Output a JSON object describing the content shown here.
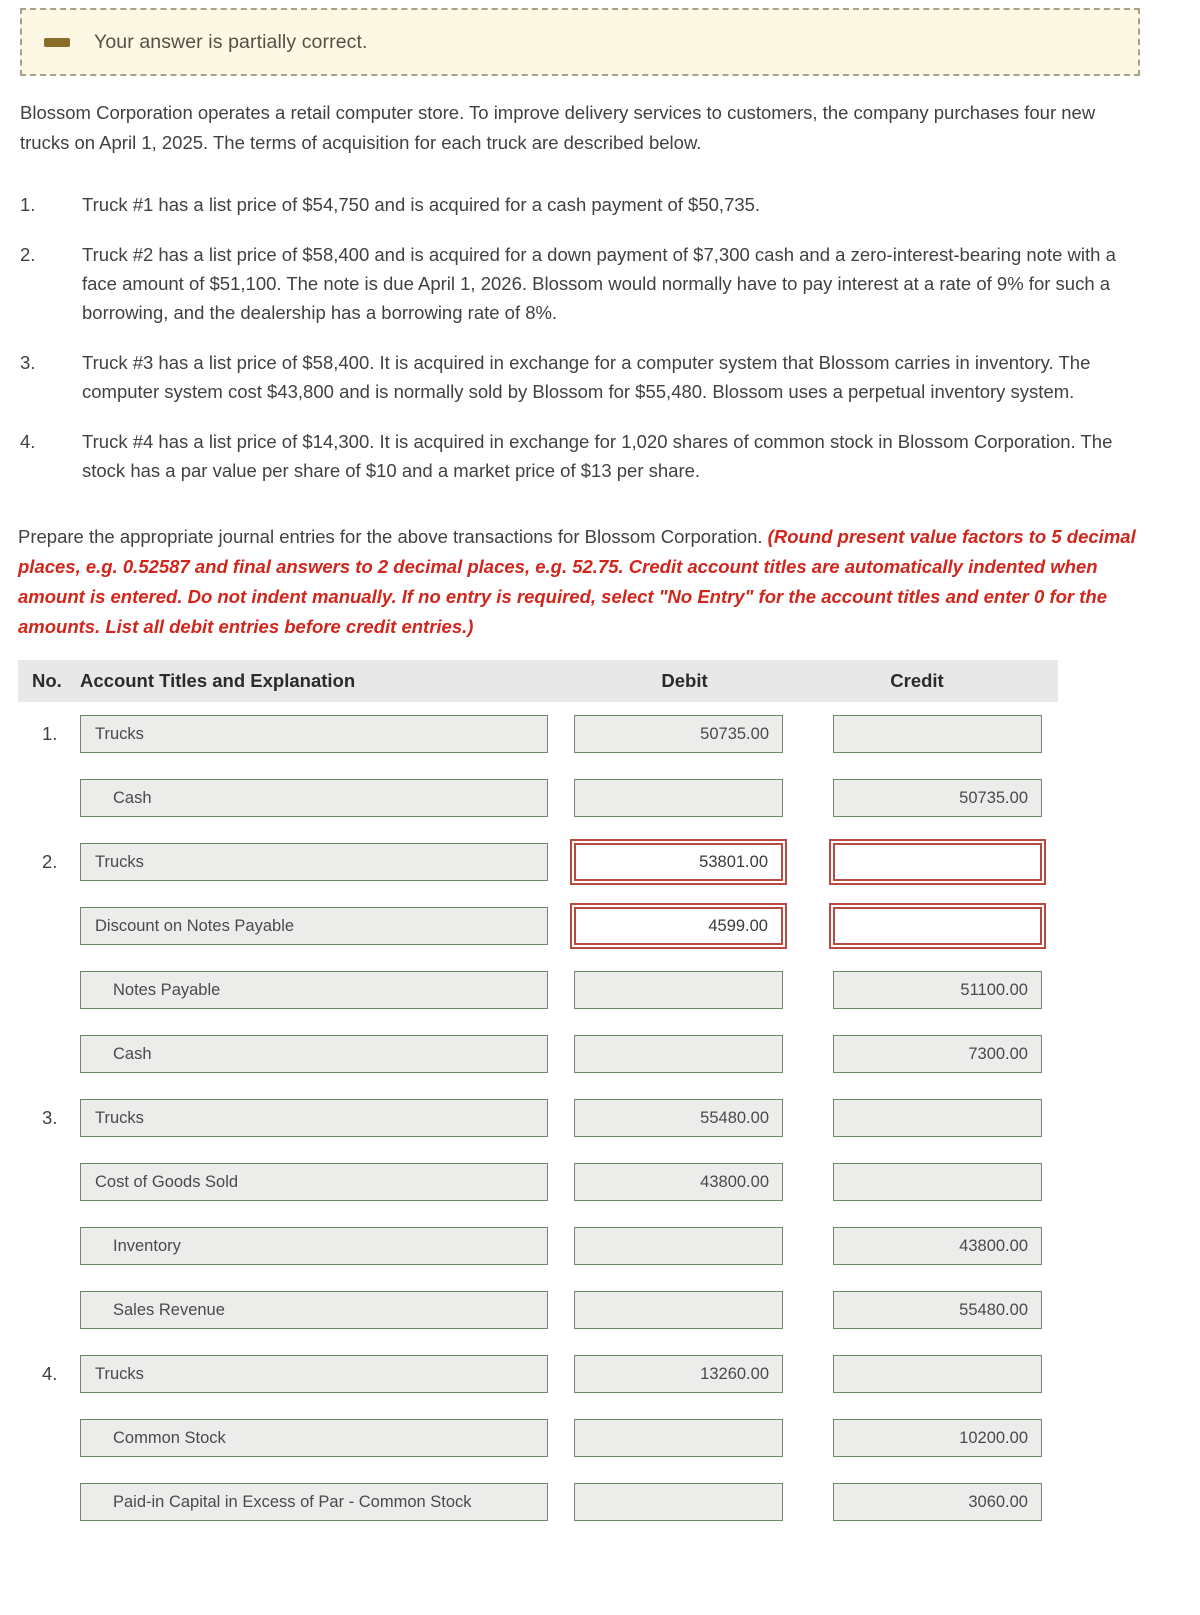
{
  "alert": {
    "icon": "minus-icon",
    "message": "Your answer is partially correct."
  },
  "intro": "Blossom Corporation operates a retail computer store. To improve delivery services to customers, the company purchases four new trucks on April 1, 2025. The terms of acquisition for each truck are described below.",
  "items": [
    {
      "num": "1.",
      "text": "Truck #1 has a list price of $54,750 and is acquired for a cash payment of $50,735."
    },
    {
      "num": "2.",
      "text": "Truck #2 has a list price of $58,400 and is acquired for a down payment of $7,300 cash and a zero-interest-bearing note with a face amount of $51,100. The note is due April 1, 2026. Blossom would normally have to pay interest at a rate of 9% for such a borrowing, and the dealership has a borrowing rate of 8%."
    },
    {
      "num": "3.",
      "text": "Truck #3 has a list price of $58,400. It is acquired in exchange for a computer system that Blossom carries in inventory. The computer system cost $43,800 and is normally sold by Blossom for $55,480. Blossom uses a perpetual inventory system."
    },
    {
      "num": "4.",
      "text": "Truck #4 has a list price of $14,300. It is acquired in exchange for 1,020 shares of common stock in Blossom Corporation. The stock has a par value per share of $10 and a market price of $13 per share."
    }
  ],
  "instructions": {
    "lead": "Prepare the appropriate journal entries for the above transactions for Blossom Corporation. ",
    "emphasis": "(Round present value factors to 5 decimal places, e.g. 0.52587 and final answers to 2 decimal places, e.g. 52.75. Credit account titles are automatically indented when amount is entered. Do not indent manually. If no entry is required, select \"No Entry\" for the account titles and enter 0 for the amounts. List all debit entries before credit entries.)"
  },
  "table": {
    "headers": {
      "no": "No.",
      "account": "Account Titles and Explanation",
      "debit": "Debit",
      "credit": "Credit"
    },
    "rows": [
      {
        "no": "1.",
        "account": "Trucks",
        "indent": false,
        "debit": "50735.00",
        "credit": "",
        "error": false
      },
      {
        "no": "",
        "account": "Cash",
        "indent": true,
        "debit": "",
        "credit": "50735.00",
        "error": false
      },
      {
        "no": "2.",
        "account": "Trucks",
        "indent": false,
        "debit": "53801.00",
        "credit": "",
        "error": true
      },
      {
        "no": "",
        "account": "Discount on Notes Payable",
        "indent": false,
        "debit": "4599.00",
        "credit": "",
        "error": true
      },
      {
        "no": "",
        "account": "Notes Payable",
        "indent": true,
        "debit": "",
        "credit": "51100.00",
        "error": false
      },
      {
        "no": "",
        "account": "Cash",
        "indent": true,
        "debit": "",
        "credit": "7300.00",
        "error": false
      },
      {
        "no": "3.",
        "account": "Trucks",
        "indent": false,
        "debit": "55480.00",
        "credit": "",
        "error": false
      },
      {
        "no": "",
        "account": "Cost of Goods Sold",
        "indent": false,
        "debit": "43800.00",
        "credit": "",
        "error": false
      },
      {
        "no": "",
        "account": "Inventory",
        "indent": true,
        "debit": "",
        "credit": "43800.00",
        "error": false
      },
      {
        "no": "",
        "account": "Sales Revenue",
        "indent": true,
        "debit": "",
        "credit": "55480.00",
        "error": false
      },
      {
        "no": "4.",
        "account": "Trucks",
        "indent": false,
        "debit": "13260.00",
        "credit": "",
        "error": false
      },
      {
        "no": "",
        "account": "Common Stock",
        "indent": true,
        "debit": "",
        "credit": "10200.00",
        "error": false
      },
      {
        "no": "",
        "account": "Paid-in Capital in Excess of Par - Common Stock",
        "indent": true,
        "debit": "",
        "credit": "3060.00",
        "error": false
      }
    ]
  },
  "colors": {
    "alert_bg": "#fcf8e3",
    "alert_border": "#a9a08a",
    "alert_icon": "#8a6d29",
    "emphasis_text": "#d0261c",
    "field_border": "#6d8a6d",
    "field_bg": "#ecedeb",
    "error_border": "#b84a43",
    "header_bg": "#e8e8e8"
  }
}
